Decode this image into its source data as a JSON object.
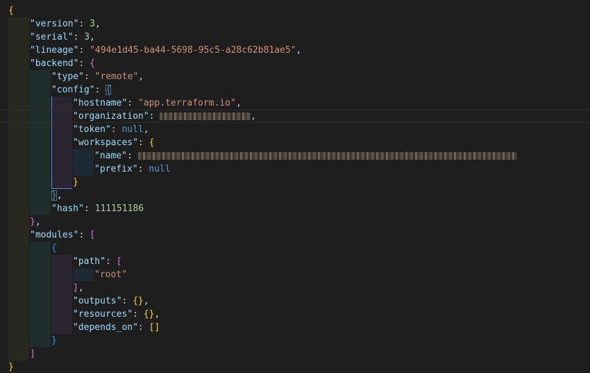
{
  "theme": {
    "background": "#1e1e1e",
    "key_color": "#9cdcfe",
    "string_color": "#ce9178",
    "number_color": "#b5cea8",
    "keyword_color": "#569cd6",
    "bracket_colors": [
      "#ffd700",
      "#da70d6",
      "#179fff"
    ],
    "active_guide_color": "#4d8be8"
  },
  "editor": {
    "current_line": 8,
    "lines": [
      {
        "indent": 0,
        "tokens": [
          {
            "t": "{",
            "c": "b1"
          }
        ]
      },
      {
        "indent": 1,
        "tokens": [
          {
            "t": "\"version\"",
            "c": "key"
          },
          {
            "t": ": ",
            "c": "punc"
          },
          {
            "t": "3",
            "c": "num"
          },
          {
            "t": ",",
            "c": "punc"
          }
        ]
      },
      {
        "indent": 1,
        "tokens": [
          {
            "t": "\"serial\"",
            "c": "key"
          },
          {
            "t": ": ",
            "c": "punc"
          },
          {
            "t": "3",
            "c": "num"
          },
          {
            "t": ",",
            "c": "punc"
          }
        ]
      },
      {
        "indent": 1,
        "tokens": [
          {
            "t": "\"lineage\"",
            "c": "key"
          },
          {
            "t": ": ",
            "c": "punc"
          },
          {
            "t": "\"494e1d45-ba44-5698-95c5-a28c62b81ae5\"",
            "c": "str"
          },
          {
            "t": ",",
            "c": "punc"
          }
        ]
      },
      {
        "indent": 1,
        "tokens": [
          {
            "t": "\"backend\"",
            "c": "key"
          },
          {
            "t": ": ",
            "c": "punc"
          },
          {
            "t": "{",
            "c": "b2"
          }
        ]
      },
      {
        "indent": 2,
        "tokens": [
          {
            "t": "\"type\"",
            "c": "key"
          },
          {
            "t": ": ",
            "c": "punc"
          },
          {
            "t": "\"remote\"",
            "c": "str"
          },
          {
            "t": ",",
            "c": "punc"
          }
        ]
      },
      {
        "indent": 2,
        "tokens": [
          {
            "t": "\"config\"",
            "c": "key"
          },
          {
            "t": ": ",
            "c": "punc"
          },
          {
            "t": "{",
            "c": "b3",
            "match": true
          }
        ]
      },
      {
        "indent": 3,
        "tokens": [
          {
            "t": "\"hostname\"",
            "c": "key"
          },
          {
            "t": ": ",
            "c": "punc"
          },
          {
            "t": "\"app.terraform.io\"",
            "c": "str"
          },
          {
            "t": ",",
            "c": "punc"
          }
        ]
      },
      {
        "indent": 3,
        "tokens": [
          {
            "t": "\"organization\"",
            "c": "key"
          },
          {
            "t": ": ",
            "c": "punc"
          },
          {
            "redacted": 17
          },
          {
            "t": ",",
            "c": "punc"
          }
        ]
      },
      {
        "indent": 3,
        "tokens": [
          {
            "t": "\"token\"",
            "c": "key"
          },
          {
            "t": ": ",
            "c": "punc"
          },
          {
            "t": "null",
            "c": "kw"
          },
          {
            "t": ",",
            "c": "punc"
          }
        ]
      },
      {
        "indent": 3,
        "tokens": [
          {
            "t": "\"workspaces\"",
            "c": "key"
          },
          {
            "t": ": ",
            "c": "punc"
          },
          {
            "t": "{",
            "c": "b1"
          }
        ]
      },
      {
        "indent": 4,
        "tokens": [
          {
            "t": "\"name\"",
            "c": "key"
          },
          {
            "t": ": ",
            "c": "punc"
          },
          {
            "redacted": 71
          }
        ]
      },
      {
        "indent": 4,
        "tokens": [
          {
            "t": "\"prefix\"",
            "c": "key"
          },
          {
            "t": ": ",
            "c": "punc"
          },
          {
            "t": "null",
            "c": "kw"
          }
        ]
      },
      {
        "indent": 3,
        "tokens": [
          {
            "t": "}",
            "c": "b1"
          }
        ]
      },
      {
        "indent": 2,
        "tokens": [
          {
            "t": "}",
            "c": "b3",
            "match": true
          },
          {
            "t": ",",
            "c": "punc"
          }
        ]
      },
      {
        "indent": 2,
        "tokens": [
          {
            "t": "\"hash\"",
            "c": "key"
          },
          {
            "t": ": ",
            "c": "punc"
          },
          {
            "t": "111151186",
            "c": "num"
          }
        ]
      },
      {
        "indent": 1,
        "tokens": [
          {
            "t": "}",
            "c": "b2"
          },
          {
            "t": ",",
            "c": "punc"
          }
        ]
      },
      {
        "indent": 1,
        "tokens": [
          {
            "t": "\"modules\"",
            "c": "key"
          },
          {
            "t": ": ",
            "c": "punc"
          },
          {
            "t": "[",
            "c": "b2"
          }
        ]
      },
      {
        "indent": 2,
        "tokens": [
          {
            "t": "{",
            "c": "b3"
          }
        ]
      },
      {
        "indent": 3,
        "tokens": [
          {
            "t": "\"path\"",
            "c": "key"
          },
          {
            "t": ": ",
            "c": "punc"
          },
          {
            "t": "[",
            "c": "b2"
          }
        ]
      },
      {
        "indent": 4,
        "tokens": [
          {
            "t": "\"root\"",
            "c": "str"
          }
        ]
      },
      {
        "indent": 3,
        "tokens": [
          {
            "t": "]",
            "c": "b2"
          },
          {
            "t": ",",
            "c": "punc"
          }
        ]
      },
      {
        "indent": 3,
        "tokens": [
          {
            "t": "\"outputs\"",
            "c": "key"
          },
          {
            "t": ": ",
            "c": "punc"
          },
          {
            "t": "{}",
            "c": "b1"
          },
          {
            "t": ",",
            "c": "punc"
          }
        ]
      },
      {
        "indent": 3,
        "tokens": [
          {
            "t": "\"resources\"",
            "c": "key"
          },
          {
            "t": ": ",
            "c": "punc"
          },
          {
            "t": "{}",
            "c": "b1"
          },
          {
            "t": ",",
            "c": "punc"
          }
        ]
      },
      {
        "indent": 3,
        "tokens": [
          {
            "t": "\"depends_on\"",
            "c": "key"
          },
          {
            "t": ": ",
            "c": "punc"
          },
          {
            "t": "[]",
            "c": "b1"
          }
        ]
      },
      {
        "indent": 2,
        "tokens": [
          {
            "t": "}",
            "c": "b3"
          }
        ]
      },
      {
        "indent": 1,
        "tokens": [
          {
            "t": "]",
            "c": "b2"
          }
        ]
      },
      {
        "indent": 0,
        "tokens": [
          {
            "t": "}",
            "c": "b1"
          }
        ]
      }
    ]
  }
}
